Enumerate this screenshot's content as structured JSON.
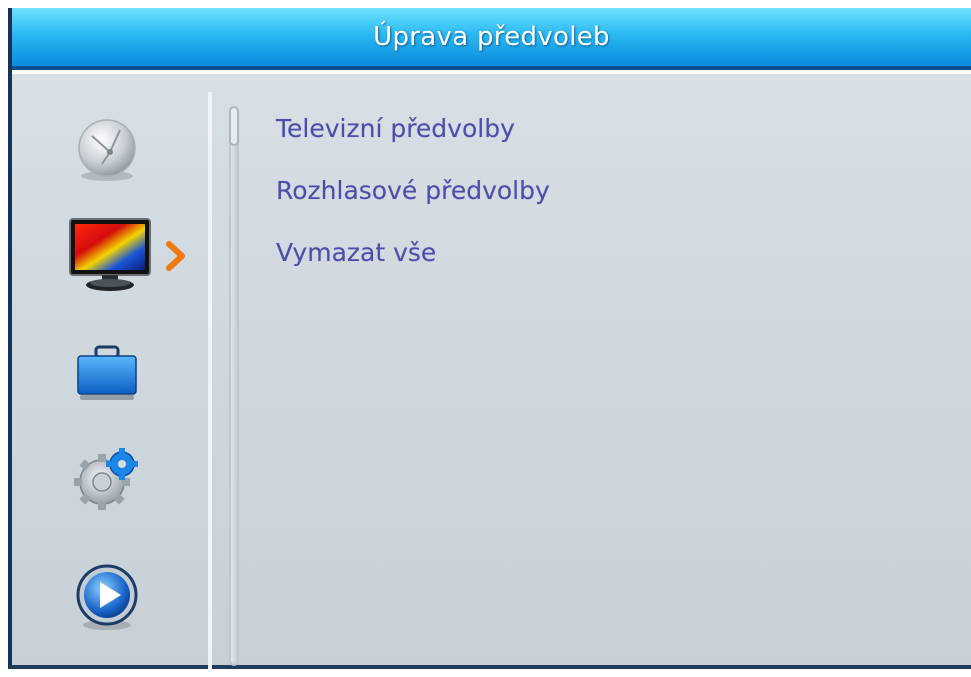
{
  "window": {
    "title": "Úprava předvoleb"
  },
  "sidebar": {
    "items": [
      {
        "icon": "satellite-dish-icon"
      },
      {
        "icon": "tv-monitor-icon",
        "selected": true
      },
      {
        "icon": "briefcase-icon"
      },
      {
        "icon": "gear-settings-icon"
      },
      {
        "icon": "play-icon"
      }
    ],
    "selected_indicator_icon": "chevron-right-icon"
  },
  "menu": {
    "items": [
      {
        "label": "Televizní předvolby"
      },
      {
        "label": "Rozhlasové předvolby"
      },
      {
        "label": "Vymazat vše"
      }
    ]
  },
  "colors": {
    "titlebar": "#2ab9f3",
    "background": "#ccd5dc",
    "menu_text": "#4a4ea8",
    "selection_arrow": "#f07a12"
  }
}
